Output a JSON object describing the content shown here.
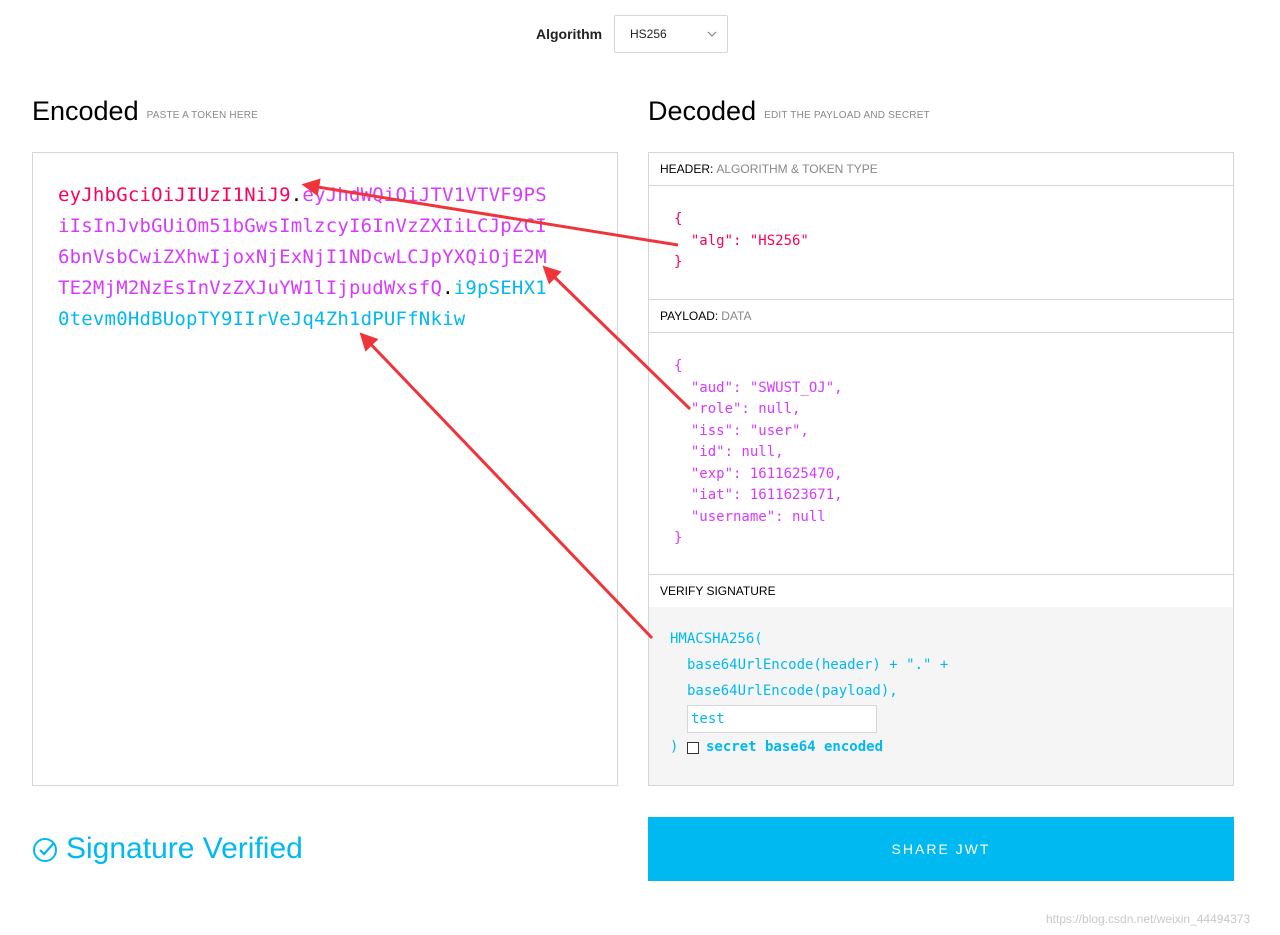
{
  "algorithm": {
    "label": "Algorithm",
    "selected": "HS256",
    "chevron_icon": "chevron-down-icon"
  },
  "encoded": {
    "title": "Encoded",
    "subtitle": "PASTE A TOKEN HERE",
    "header_part": "eyJhbGciOiJIUzI1NiJ9",
    "payload_part": "eyJhdWQiOiJTV1VTVF9PSiIsInJvbGUiOm51bGwsImlzcyI6InVzZXIiLCJpZCI6bnVsbCwiZXhwIjoxNjExNjI1NDcwLCJpYXQiOjE2MTE2MjM2NzEsInVzZXJuYW1lIjpudWxsfQ",
    "signature_part": "i9pSEHX10tevm0HdBUopTY9IIrVeJq4Zh1dPUFfNkiw",
    "dot": "."
  },
  "decoded": {
    "title": "Decoded",
    "subtitle": "EDIT THE PAYLOAD AND SECRET",
    "header_section": {
      "label": "HEADER:",
      "desc": "ALGORITHM & TOKEN TYPE",
      "json": "{\n  \"alg\": \"HS256\"\n}"
    },
    "payload_section": {
      "label": "PAYLOAD:",
      "desc": "DATA",
      "json": "{\n  \"aud\": \"SWUST_OJ\",\n  \"role\": null,\n  \"iss\": \"user\",\n  \"id\": null,\n  \"exp\": 1611625470,\n  \"iat\": 1611623671,\n  \"username\": null\n}"
    },
    "signature_section": {
      "label": "VERIFY SIGNATURE",
      "line1": "HMACSHA256(",
      "line2": "base64UrlEncode(header) + \".\" +",
      "line3": "base64UrlEncode(payload),",
      "secret_value": "test",
      "close_paren": ")",
      "checkbox_label": "secret base64 encoded"
    }
  },
  "status": {
    "text": "Signature Verified",
    "icon": "check-circle-icon"
  },
  "share_button": "SHARE JWT",
  "watermark": "https://blog.csdn.net/weixin_44494373",
  "colors": {
    "header": "#fb015b",
    "payload": "#d63aff",
    "signature": "#00b9f1",
    "annotation_arrow": "#f0353a"
  }
}
